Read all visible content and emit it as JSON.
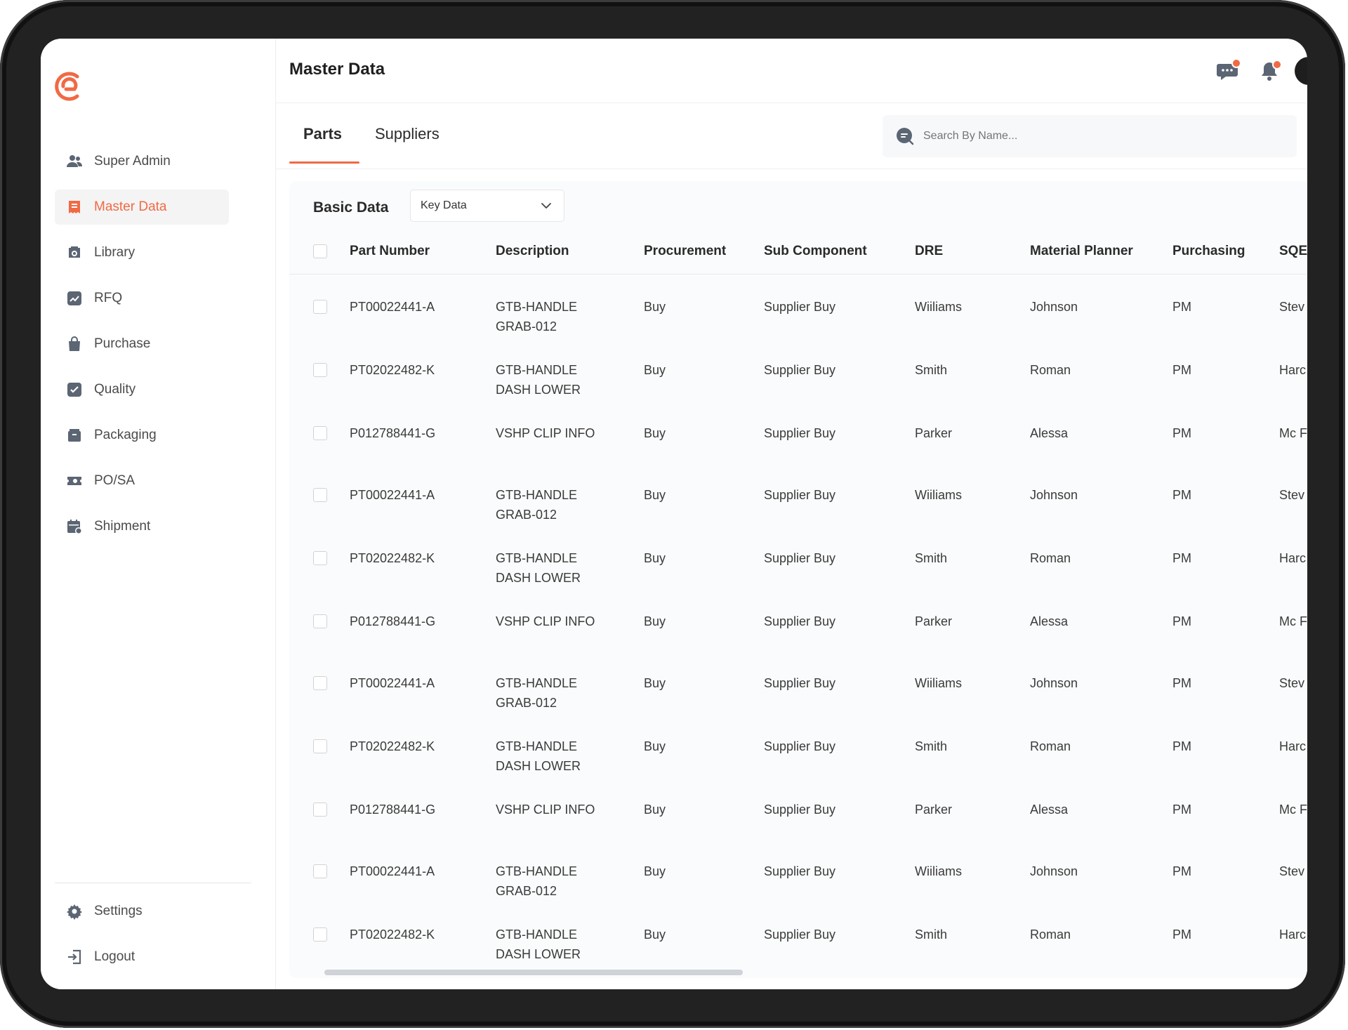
{
  "app": {
    "brand_color": "#f06a45"
  },
  "sidebar": {
    "items": [
      {
        "label": "Super Admin",
        "icon": "users-icon"
      },
      {
        "label": "Master Data",
        "icon": "document-icon",
        "active": true
      },
      {
        "label": "Library",
        "icon": "library-icon"
      },
      {
        "label": "RFQ",
        "icon": "chart-icon"
      },
      {
        "label": "Purchase",
        "icon": "bag-icon"
      },
      {
        "label": "Quality",
        "icon": "check-icon"
      },
      {
        "label": "Packaging",
        "icon": "box-icon"
      },
      {
        "label": "PO/SA",
        "icon": "ticket-icon"
      },
      {
        "label": "Shipment",
        "icon": "calendar-icon"
      }
    ],
    "bottom": [
      {
        "label": "Settings",
        "icon": "gear-icon"
      },
      {
        "label": "Logout",
        "icon": "logout-icon"
      }
    ]
  },
  "header": {
    "title": "Master Data"
  },
  "tabs": [
    {
      "label": "Parts",
      "active": true
    },
    {
      "label": "Suppliers"
    }
  ],
  "search": {
    "placeholder": "Search By Name..."
  },
  "content": {
    "section_title": "Basic Data",
    "select_value": "Key Data"
  },
  "table": {
    "columns": [
      "Part Number",
      "Description",
      "Procurement",
      "Sub Component",
      "DRE",
      "Material Planner",
      "Purchasing",
      "SQE"
    ],
    "rows": [
      [
        "PT00022441-A",
        "GTB-HANDLE GRAB-012",
        "Buy",
        "Supplier Buy",
        "Wiiliams",
        "Johnson",
        "PM",
        "Stev"
      ],
      [
        "PT02022482-K",
        "GTB-HANDLE DASH LOWER",
        "Buy",
        "Supplier Buy",
        "Smith",
        "Roman",
        "PM",
        "Harc"
      ],
      [
        "P012788441-G",
        "VSHP CLIP INFO",
        "Buy",
        "Supplier Buy",
        "Parker",
        "Alessa",
        "PM",
        "Mc F"
      ],
      [
        "PT00022441-A",
        "GTB-HANDLE GRAB-012",
        "Buy",
        "Supplier Buy",
        "Wiiliams",
        "Johnson",
        "PM",
        "Stev"
      ],
      [
        "PT02022482-K",
        "GTB-HANDLE DASH LOWER",
        "Buy",
        "Supplier Buy",
        "Smith",
        "Roman",
        "PM",
        "Harc"
      ],
      [
        "P012788441-G",
        "VSHP CLIP INFO",
        "Buy",
        "Supplier Buy",
        "Parker",
        "Alessa",
        "PM",
        "Mc F"
      ],
      [
        "PT00022441-A",
        "GTB-HANDLE GRAB-012",
        "Buy",
        "Supplier Buy",
        "Wiiliams",
        "Johnson",
        "PM",
        "Stev"
      ],
      [
        "PT02022482-K",
        "GTB-HANDLE DASH LOWER",
        "Buy",
        "Supplier Buy",
        "Smith",
        "Roman",
        "PM",
        "Harc"
      ],
      [
        "P012788441-G",
        "VSHP CLIP INFO",
        "Buy",
        "Supplier Buy",
        "Parker",
        "Alessa",
        "PM",
        "Mc F"
      ],
      [
        "PT00022441-A",
        "GTB-HANDLE GRAB-012",
        "Buy",
        "Supplier Buy",
        "Wiiliams",
        "Johnson",
        "PM",
        "Stev"
      ],
      [
        "PT02022482-K",
        "GTB-HANDLE DASH LOWER",
        "Buy",
        "Supplier Buy",
        "Smith",
        "Roman",
        "PM",
        "Harc"
      ]
    ]
  }
}
